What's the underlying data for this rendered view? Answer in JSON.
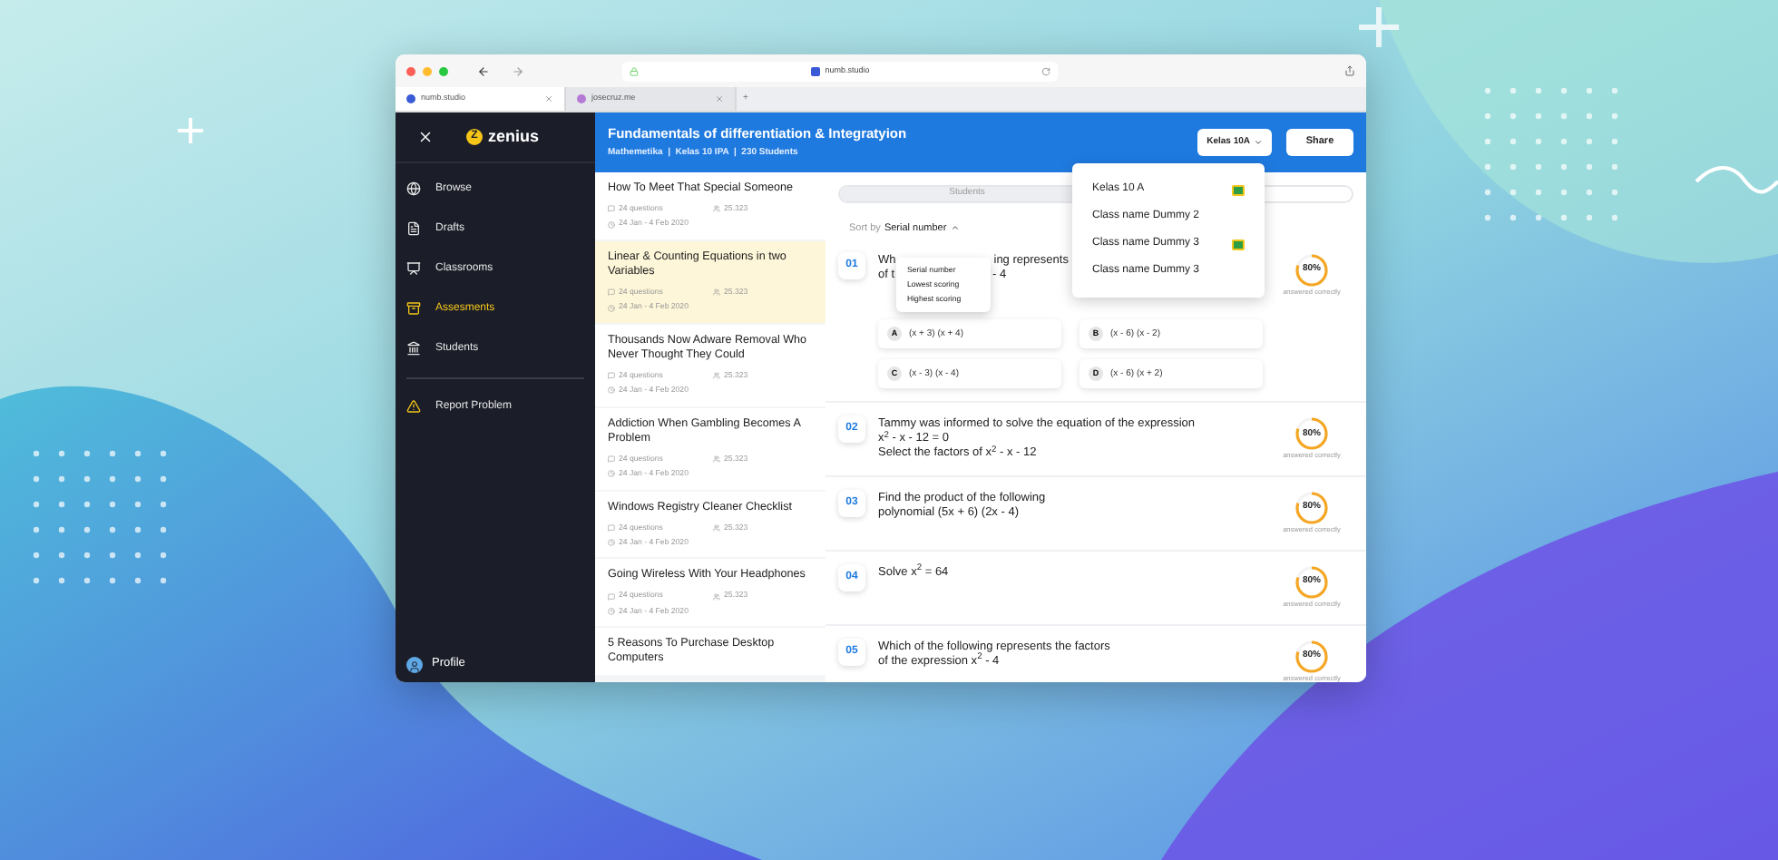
{
  "browser": {
    "address": "numb.studio",
    "tabs": [
      {
        "label": "numb.studio",
        "selected": true
      },
      {
        "label": "josecruz.me",
        "selected": false
      }
    ],
    "new_tab": "+"
  },
  "sidebar": {
    "logo": {
      "mark": "Z",
      "name": "zenius"
    },
    "items": [
      {
        "label": "Browse",
        "selected": false
      },
      {
        "label": "Drafts",
        "selected": false
      },
      {
        "label": "Classrooms",
        "selected": false
      },
      {
        "label": "Assesments",
        "selected": true
      },
      {
        "label": "Students",
        "selected": false
      }
    ],
    "footer_items": [
      {
        "label": "Report Problem"
      }
    ],
    "profile": "Profile"
  },
  "header": {
    "title": "Fundamentals of differentiation & Integratyion",
    "subtitle": "Mathemetika  |  Kelas 10 IPA  |  230 Students",
    "class_button": "Kelas 10A",
    "share_button": "Share"
  },
  "assessments": [
    {
      "title": "How To Meet That Special Someone",
      "questions": "24 questions",
      "count": "25.323",
      "dates": "24 Jan - 4 Feb 2020",
      "selected": false
    },
    {
      "title": "Linear & Counting Equations in two Variables",
      "questions": "24 questions",
      "count": "25.323",
      "dates": "24 Jan - 4 Feb 2020",
      "selected": true
    },
    {
      "title": "Thousands Now Adware Removal Who Never Thought They Could",
      "questions": "24 questions",
      "count": "25.323",
      "dates": "24 Jan - 4 Feb 2020",
      "selected": false
    },
    {
      "title": "Addiction When Gambling Becomes A Problem",
      "questions": "24 questions",
      "count": "25.323",
      "dates": "24 Jan - 4 Feb 2020",
      "selected": false
    },
    {
      "title": "Windows Registry Cleaner Checklist",
      "questions": "24 questions",
      "count": "25.323",
      "dates": "24 Jan - 4 Feb 2020",
      "selected": false
    },
    {
      "title": "Going Wireless With Your Headphones",
      "questions": "24 questions",
      "count": "25.323",
      "dates": "24 Jan - 4 Feb 2020",
      "selected": false
    },
    {
      "title": "5 Reasons To Purchase Desktop Computers",
      "selected": false
    }
  ],
  "view_tabs": [
    {
      "label": "Students",
      "selected": false
    }
  ],
  "sort": {
    "label": "Sort by",
    "value": "Serial number",
    "expanded": true,
    "options": [
      "Serial number",
      "Lowest scoring",
      "Highest scoring"
    ]
  },
  "class_menu": {
    "open": true,
    "items": [
      {
        "label": "Kelas 10 A",
        "linked": true
      },
      {
        "label": "Class name Dummy 2",
        "linked": false
      },
      {
        "label": "Class name Dummy 3",
        "linked": true
      },
      {
        "label": "Class name Dummy 3",
        "linked": false
      }
    ]
  },
  "questions": [
    {
      "number": "01",
      "lines": [
        [
          "Wh",
          "ing represents"
        ],
        [
          "of t",
          "- 4"
        ]
      ],
      "score": "80%",
      "score_label": "answered correctly",
      "options": [
        {
          "letter": "A",
          "text": "(x + 3) (x + 4)"
        },
        {
          "letter": "B",
          "text": "(x - 6) (x - 2)"
        },
        {
          "letter": "C",
          "text": "(x - 3) (x - 4)"
        },
        {
          "letter": "D",
          "text": "(x - 6) (x + 2)"
        }
      ]
    },
    {
      "number": "02",
      "lines": [
        [
          "Tammy was informed to solve the equation of the expression"
        ],
        [
          "x$^{2}$ - x - 12 = 0"
        ],
        [
          "Select the factors of x$^{2}$ - x - 12"
        ]
      ],
      "score": "80%",
      "score_label": "answered correctly"
    },
    {
      "number": "03",
      "lines": [
        [
          "Find the product of the following"
        ],
        [
          "polynomial (5x + 6) (2x - 4)"
        ]
      ],
      "score": "80%",
      "score_label": "answered correctly"
    },
    {
      "number": "04",
      "lines": [
        [
          "Solve x$^{2}$ = 64"
        ]
      ],
      "score": "80%",
      "score_label": "answered correctly"
    },
    {
      "number": "05",
      "lines": [
        [
          "Which of the following represents the factors"
        ],
        [
          "of the expression  x$^{2}$ - 4"
        ]
      ],
      "score": "80%",
      "score_label": "answered correctly"
    }
  ]
}
